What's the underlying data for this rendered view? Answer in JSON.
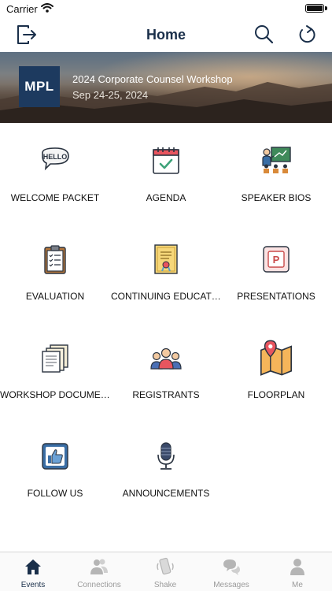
{
  "status_bar": {
    "carrier": "Carrier"
  },
  "nav": {
    "title": "Home"
  },
  "event": {
    "logo_text": "MPL",
    "title": "2024 Corporate Counsel Workshop",
    "dates": "Sep 24-25, 2024"
  },
  "tiles": [
    {
      "label": "WELCOME PACKET",
      "icon": "hello-speech-bubble-icon"
    },
    {
      "label": "AGENDA",
      "icon": "calendar-check-icon"
    },
    {
      "label": "SPEAKER BIOS",
      "icon": "presenter-icon"
    },
    {
      "label": "EVALUATION",
      "icon": "clipboard-icon"
    },
    {
      "label": "CONTINUING EDUCATI...",
      "icon": "certificate-icon"
    },
    {
      "label": "PRESENTATIONS",
      "icon": "powerpoint-icon"
    },
    {
      "label": "WORKSHOP DOCUMEN...",
      "icon": "documents-icon"
    },
    {
      "label": "REGISTRANTS",
      "icon": "people-group-icon"
    },
    {
      "label": "FLOORPLAN",
      "icon": "map-pin-icon"
    },
    {
      "label": "FOLLOW US",
      "icon": "thumbs-up-icon"
    },
    {
      "label": "ANNOUNCEMENTS",
      "icon": "microphone-icon"
    }
  ],
  "tabs": [
    {
      "label": "Events",
      "icon": "house-icon",
      "active": true
    },
    {
      "label": "Connections",
      "icon": "connections-icon",
      "active": false
    },
    {
      "label": "Shake",
      "icon": "shake-phone-icon",
      "active": false
    },
    {
      "label": "Messages",
      "icon": "chat-bubbles-icon",
      "active": false
    },
    {
      "label": "Me",
      "icon": "person-icon",
      "active": false
    }
  ],
  "colors": {
    "primary": "#1a2f4a",
    "inactive": "#9a9a9a",
    "logo_bg": "#1d3a5f"
  }
}
